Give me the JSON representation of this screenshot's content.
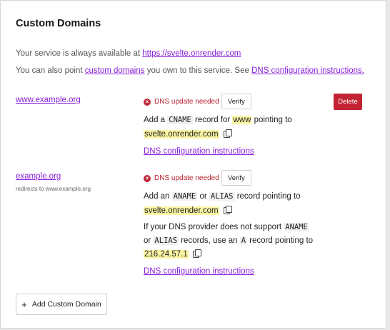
{
  "title": "Custom Domains",
  "intro": {
    "line1_prefix": "Your service is always available at ",
    "service_url": "https://svelte.onrender.com",
    "line2_prefix": "You can also point ",
    "custom_domains_link": "custom domains",
    "line2_middle": " you own to this service. See ",
    "dns_instructions_link": "DNS configuration instructions."
  },
  "domains": [
    {
      "name": "www.example.org",
      "status": "DNS update needed",
      "verify_label": "Verify",
      "delete_label": "Delete",
      "instr_add": "Add a ",
      "record_type": "CNAME",
      "instr_for": " record for ",
      "host": "www",
      "instr_pointing": " pointing to",
      "target": "svelte.onrender.com",
      "dns_link": "DNS configuration instructions"
    },
    {
      "name": "example.org",
      "redirect_note": "redirects to www.example.org",
      "status": "DNS update needed",
      "verify_label": "Verify",
      "instr_add": "Add an ",
      "record_type_1": "ANAME",
      "instr_or": " or ",
      "record_type_2": "ALIAS",
      "instr_pointing": " record pointing to",
      "target": "svelte.onrender.com",
      "alt_1": "If your DNS provider does not support ",
      "alt_record_1": "ANAME",
      "alt_2": "or ",
      "alt_record_2": "ALIAS",
      "alt_3": " records, use an ",
      "alt_record_3": "A",
      "alt_4": " record pointing to",
      "ip": "216.24.57.1",
      "dns_link": "DNS configuration instructions"
    }
  ],
  "add_button": {
    "label": "Add Custom Domain",
    "icon": "+"
  },
  "colors": {
    "link": "#8a1fd8",
    "error": "#b8232f",
    "delete_bg": "#c22433",
    "highlight": "#fbf6a4"
  }
}
